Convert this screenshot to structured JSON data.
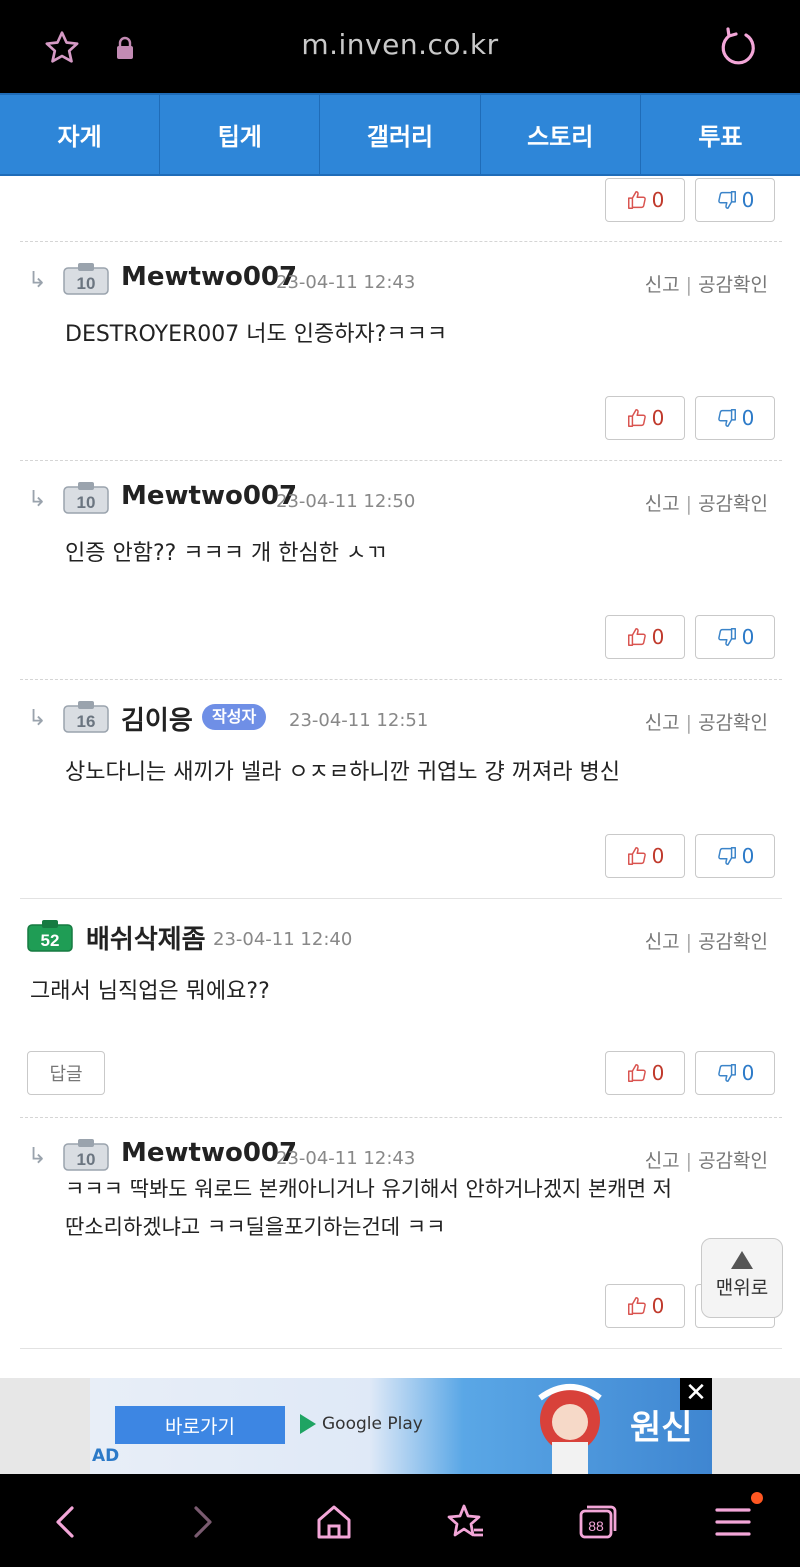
{
  "browser": {
    "url": "m.inven.co.kr",
    "icons": [
      "star-icon",
      "lock-icon",
      "reload-icon"
    ]
  },
  "tabs": [
    "자게",
    "팁게",
    "갤러리",
    "스토리",
    "투표"
  ],
  "top_votes": {
    "up": "0",
    "down": "0"
  },
  "comments": [
    {
      "level": "10",
      "author": "Mewtwo007",
      "date": "23-04-11 12:43",
      "report": "신고",
      "like_check": "공감확인",
      "text": "DESTROYER007 너도 인증하자?ㅋㅋㅋ",
      "up": "0",
      "down": "0"
    },
    {
      "level": "10",
      "author": "Mewtwo007",
      "date": "23-04-11 12:50",
      "report": "신고",
      "like_check": "공감확인",
      "text": "인증 안함??  ㅋㅋㅋ 개 한심한 ㅅㄲ",
      "up": "0",
      "down": "0"
    },
    {
      "level": "16",
      "author": "김이응",
      "badge": "작성자",
      "date": "23-04-11 12:51",
      "report": "신고",
      "like_check": "공감확인",
      "text": "상노다니는 새끼가 넬라 ㅇㅈㄹ하니깐 귀엽노 걍 꺼져라 병신",
      "up": "0",
      "down": "0"
    },
    {
      "level": "52",
      "author": "배쉬삭제좀",
      "date": "23-04-11 12:40",
      "report": "신고",
      "like_check": "공감확인",
      "text": "그래서 님직업은 뭐에요??",
      "reply_label": "답글",
      "up": "0",
      "down": "0"
    },
    {
      "level": "10",
      "author": "Mewtwo007",
      "date": "23-04-11 12:43",
      "report": "신고",
      "like_check": "공감확인",
      "text_line1": "ㅋㅋㅋ  딱봐도 워로드 본캐아니거나 유기해서 안하거나겠지 본캐면 저",
      "text_line2": "딴소리하겠냐고 ㅋㅋ딜을포기하는건데 ㅋㅋ",
      "up": "0"
    }
  ],
  "to_top": "맨위로",
  "ad": {
    "button": "바로가기",
    "store": "Google Play",
    "game_logo": "원신",
    "label": "AD",
    "close": "✕"
  },
  "colors": {
    "tab_bar": "#2e86d8",
    "level_normal": "#d9dde2",
    "level_high": "#1f9d55",
    "up_vote": "#c0392b",
    "down_vote": "#2c7ac8",
    "nav_icon": "#f3a6d8"
  },
  "nav_icons": [
    "back-icon",
    "forward-icon",
    "home-icon",
    "bookmarks-icon",
    "tabs-icon",
    "menu-icon"
  ],
  "tab_count": "88"
}
